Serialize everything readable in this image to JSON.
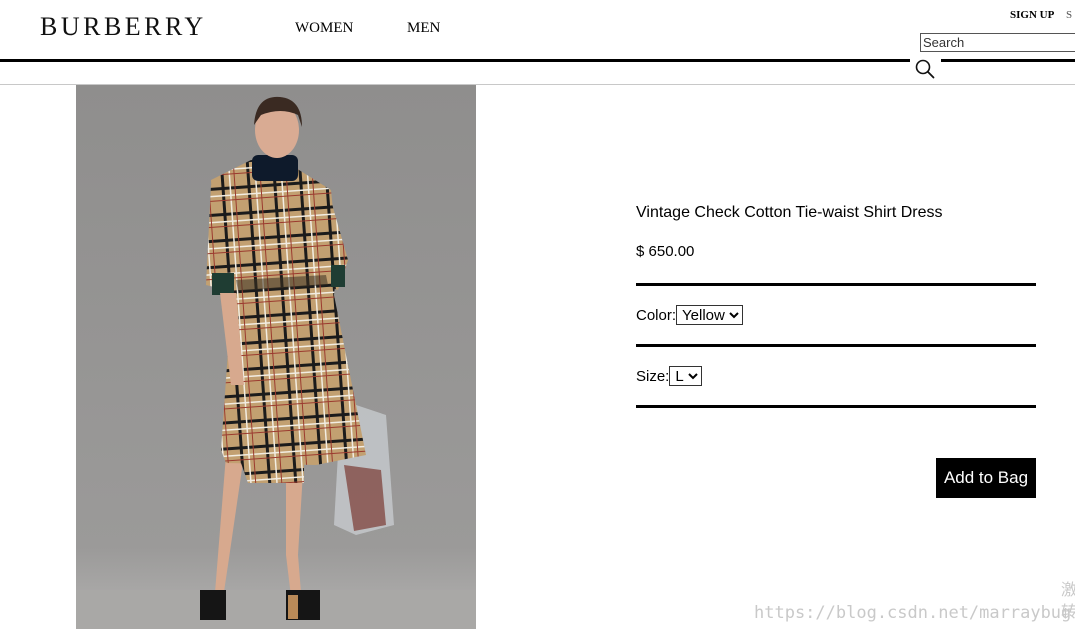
{
  "header": {
    "logo": "BURBERRY",
    "nav": [
      "WOMEN",
      "MEN"
    ],
    "sign_up": "SIGN UP",
    "sign_in_partial": "S",
    "search_placeholder": "Search"
  },
  "product": {
    "title": "Vintage Check Cotton Tie-waist Shirt Dress",
    "price": "$ 650.00",
    "color_label": "Color:",
    "color_selected": "Yellow",
    "size_label": "Size:",
    "size_selected": "L",
    "add_to_bag": "Add to Bag"
  },
  "watermark": {
    "url": "https://blog.csdn.net/marraybug",
    "side": "激转"
  },
  "colors": {
    "accent": "#000000",
    "check_base": "#c2a071",
    "background_image": "#8e8d8c"
  }
}
